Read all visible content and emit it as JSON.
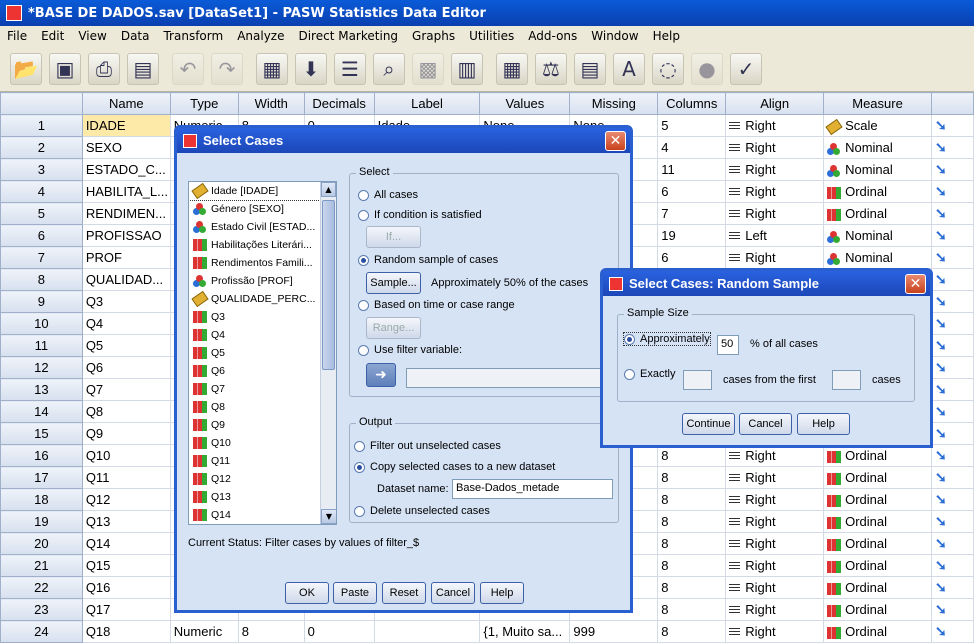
{
  "window": {
    "title": "*BASE DE DADOS.sav [DataSet1] - PASW Statistics Data Editor"
  },
  "menu": [
    "File",
    "Edit",
    "View",
    "Data",
    "Transform",
    "Analyze",
    "Direct Marketing",
    "Graphs",
    "Utilities",
    "Add-ons",
    "Window",
    "Help"
  ],
  "columns": [
    "Name",
    "Type",
    "Width",
    "Decimals",
    "Label",
    "Values",
    "Missing",
    "Columns",
    "Align",
    "Measure"
  ],
  "rows": [
    {
      "n": "1",
      "name": "IDADE",
      "type": "Numeric",
      "width": "8",
      "dec": "0",
      "label": "Idade",
      "values": "None",
      "missing": "None",
      "cols": "5",
      "align": "Right",
      "measure": "Scale",
      "m": "scale"
    },
    {
      "n": "2",
      "name": "SEXO",
      "type": "",
      "width": "",
      "dec": "",
      "label": "",
      "values": "",
      "missing": "",
      "cols": "4",
      "align": "Right",
      "measure": "Nominal",
      "m": "nominal"
    },
    {
      "n": "3",
      "name": "ESTADO_C...",
      "type": "",
      "width": "",
      "dec": "",
      "label": "",
      "values": "",
      "missing": "",
      "cols": "11",
      "align": "Right",
      "measure": "Nominal",
      "m": "nominal"
    },
    {
      "n": "4",
      "name": "HABILITA_L...",
      "type": "",
      "width": "",
      "dec": "",
      "label": "",
      "values": "",
      "missing": "",
      "cols": "6",
      "align": "Right",
      "measure": "Ordinal",
      "m": "ordinal"
    },
    {
      "n": "5",
      "name": "RENDIMEN...",
      "type": "",
      "width": "",
      "dec": "",
      "label": "",
      "values": "",
      "missing": "",
      "cols": "7",
      "align": "Right",
      "measure": "Ordinal",
      "m": "ordinal"
    },
    {
      "n": "6",
      "name": "PROFISSAO",
      "type": "",
      "width": "",
      "dec": "",
      "label": "",
      "values": "",
      "missing": "",
      "cols": "19",
      "align": "Left",
      "measure": "Nominal",
      "m": "nominal"
    },
    {
      "n": "7",
      "name": "PROF",
      "type": "",
      "width": "",
      "dec": "",
      "label": "",
      "values": "",
      "missing": "",
      "cols": "6",
      "align": "Right",
      "measure": "Nominal",
      "m": "nominal"
    },
    {
      "n": "8",
      "name": "QUALIDAD...",
      "type": "",
      "width": "",
      "dec": "",
      "label": "",
      "values": "",
      "missing": "",
      "cols": "",
      "align": "",
      "measure": "",
      "m": ""
    },
    {
      "n": "9",
      "name": "Q3",
      "type": "",
      "width": "",
      "dec": "",
      "label": "",
      "values": "",
      "missing": "",
      "cols": "",
      "align": "",
      "measure": "",
      "m": ""
    },
    {
      "n": "10",
      "name": "Q4",
      "type": "",
      "width": "",
      "dec": "",
      "label": "",
      "values": "",
      "missing": "",
      "cols": "",
      "align": "",
      "measure": "",
      "m": ""
    },
    {
      "n": "11",
      "name": "Q5",
      "type": "",
      "width": "",
      "dec": "",
      "label": "",
      "values": "",
      "missing": "",
      "cols": "",
      "align": "",
      "measure": "",
      "m": ""
    },
    {
      "n": "12",
      "name": "Q6",
      "type": "",
      "width": "",
      "dec": "",
      "label": "",
      "values": "",
      "missing": "",
      "cols": "",
      "align": "",
      "measure": "",
      "m": ""
    },
    {
      "n": "13",
      "name": "Q7",
      "type": "",
      "width": "",
      "dec": "",
      "label": "",
      "values": "",
      "missing": "",
      "cols": "",
      "align": "",
      "measure": "",
      "m": ""
    },
    {
      "n": "14",
      "name": "Q8",
      "type": "",
      "width": "",
      "dec": "",
      "label": "",
      "values": "",
      "missing": "",
      "cols": "",
      "align": "",
      "measure": "",
      "m": ""
    },
    {
      "n": "15",
      "name": "Q9",
      "type": "",
      "width": "",
      "dec": "",
      "label": "",
      "values": "",
      "missing": "",
      "cols": "",
      "align": "",
      "measure": "",
      "m": ""
    },
    {
      "n": "16",
      "name": "Q10",
      "type": "",
      "width": "",
      "dec": "",
      "label": "",
      "values": "",
      "missing": "",
      "cols": "8",
      "align": "Right",
      "measure": "Ordinal",
      "m": "ordinal"
    },
    {
      "n": "17",
      "name": "Q11",
      "type": "",
      "width": "",
      "dec": "",
      "label": "",
      "values": "",
      "missing": "",
      "cols": "8",
      "align": "Right",
      "measure": "Ordinal",
      "m": "ordinal"
    },
    {
      "n": "18",
      "name": "Q12",
      "type": "",
      "width": "",
      "dec": "",
      "label": "",
      "values": "",
      "missing": "",
      "cols": "8",
      "align": "Right",
      "measure": "Ordinal",
      "m": "ordinal"
    },
    {
      "n": "19",
      "name": "Q13",
      "type": "",
      "width": "",
      "dec": "",
      "label": "",
      "values": "",
      "missing": "",
      "cols": "8",
      "align": "Right",
      "measure": "Ordinal",
      "m": "ordinal"
    },
    {
      "n": "20",
      "name": "Q14",
      "type": "",
      "width": "",
      "dec": "",
      "label": "",
      "values": "",
      "missing": "",
      "cols": "8",
      "align": "Right",
      "measure": "Ordinal",
      "m": "ordinal"
    },
    {
      "n": "21",
      "name": "Q15",
      "type": "",
      "width": "",
      "dec": "",
      "label": "",
      "values": "",
      "missing": "",
      "cols": "8",
      "align": "Right",
      "measure": "Ordinal",
      "m": "ordinal"
    },
    {
      "n": "22",
      "name": "Q16",
      "type": "",
      "width": "",
      "dec": "",
      "label": "",
      "values": "",
      "missing": "",
      "cols": "8",
      "align": "Right",
      "measure": "Ordinal",
      "m": "ordinal"
    },
    {
      "n": "23",
      "name": "Q17",
      "type": "",
      "width": "",
      "dec": "",
      "label": "",
      "values": "",
      "missing": "",
      "cols": "8",
      "align": "Right",
      "measure": "Ordinal",
      "m": "ordinal"
    },
    {
      "n": "24",
      "name": "Q18",
      "type": "Numeric",
      "width": "8",
      "dec": "0",
      "label": "",
      "values": "{1, Muito sa...",
      "missing": "999",
      "cols": "8",
      "align": "Right",
      "measure": "Ordinal",
      "m": "ordinal"
    }
  ],
  "select_dialog": {
    "title": "Select Cases",
    "variables": [
      {
        "label": "Idade [IDADE]",
        "m": "scale"
      },
      {
        "label": "Género [SEXO]",
        "m": "nominal"
      },
      {
        "label": "Estado Civil [ESTAD...",
        "m": "nominal"
      },
      {
        "label": "Habilitações Literári...",
        "m": "ordinal"
      },
      {
        "label": "Rendimentos Famili...",
        "m": "ordinal"
      },
      {
        "label": "Profissão [PROF]",
        "m": "nominal"
      },
      {
        "label": "QUALIDADE_PERC...",
        "m": "scale"
      },
      {
        "label": "Q3",
        "m": "ordinal"
      },
      {
        "label": "Q4",
        "m": "ordinal"
      },
      {
        "label": "Q5",
        "m": "ordinal"
      },
      {
        "label": "Q6",
        "m": "ordinal"
      },
      {
        "label": "Q7",
        "m": "ordinal"
      },
      {
        "label": "Q8",
        "m": "ordinal"
      },
      {
        "label": "Q9",
        "m": "ordinal"
      },
      {
        "label": "Q10",
        "m": "ordinal"
      },
      {
        "label": "Q11",
        "m": "ordinal"
      },
      {
        "label": "Q12",
        "m": "ordinal"
      },
      {
        "label": "Q13",
        "m": "ordinal"
      },
      {
        "label": "Q14",
        "m": "ordinal"
      }
    ],
    "select_legend": "Select",
    "all_cases": "All cases",
    "if_condition": "If condition is satisfied",
    "if_button": "If...",
    "random_sample": "Random sample of cases",
    "sample_button": "Sample...",
    "sample_desc": "Approximately 50% of the cases",
    "based_time": "Based on time or case range",
    "range_button": "Range...",
    "use_filter": "Use filter variable:",
    "output_legend": "Output",
    "filter_out": "Filter out unselected cases",
    "copy_selected": "Copy selected cases to a new dataset",
    "dataset_name_label": "Dataset name:",
    "dataset_name_value": "Base-Dados_metade",
    "delete_unselected": "Delete unselected cases",
    "status": "Current Status: Filter cases by values of filter_$",
    "ok": "OK",
    "paste": "Paste",
    "reset": "Reset",
    "cancel": "Cancel",
    "help": "Help"
  },
  "random_dialog": {
    "title": "Select Cases: Random Sample",
    "legend": "Sample Size",
    "approximately": "Approximately",
    "approx_value": "50",
    "pct_label": "% of all cases",
    "exactly": "Exactly",
    "cases_from": "cases from the first",
    "cases": "cases",
    "continue": "Continue",
    "cancel": "Cancel",
    "help": "Help"
  }
}
